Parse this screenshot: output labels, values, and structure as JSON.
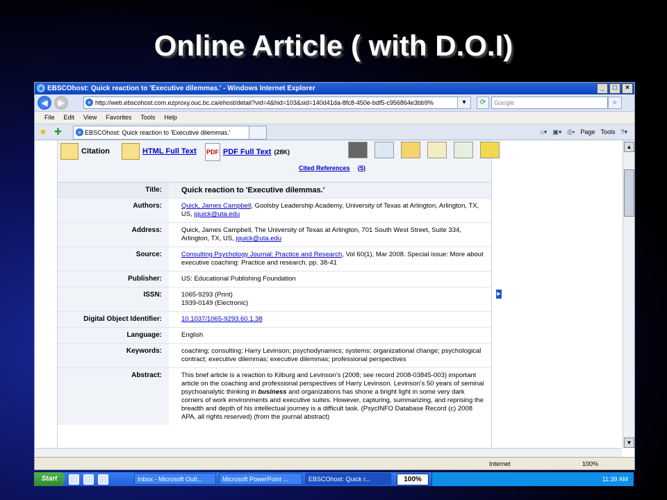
{
  "slide": {
    "title": "Online Article ( with D.O.I)"
  },
  "browser": {
    "window_title": "EBSCOhost: Quick reaction to 'Executive dilemmas.' - Windows Internet Explorer",
    "url": "http://web.ebscohost.com.ezproxy.ouc.bc.ca/ehost/detail?vid=4&hid=103&sid=140d41da-8fc8-450e-bdf5-c956864e3bb9%",
    "search_placeholder": "Google",
    "menu": [
      "File",
      "Edit",
      "View",
      "Favorites",
      "Tools",
      "Help"
    ],
    "tab_title": "EBSCOhost: Quick reaction to 'Executive dilemmas.'",
    "commands": [
      "Page",
      "Tools"
    ],
    "status": {
      "zone": "Internet",
      "zoom": "100%"
    }
  },
  "record": {
    "formats": {
      "citation": "Citation",
      "html": "HTML Full Text",
      "pdf": "PDF Full Text",
      "pdf_size": "(28K)"
    },
    "cited_references": "Cited References",
    "cited_count": "(5)",
    "fields": {
      "title_label": "Title:",
      "title": "Quick reaction to 'Executive dilemmas.'",
      "authors_label": "Authors:",
      "authors_link": "Quick, James Campbell",
      "authors_rest": ", Goolsby Leadership Academy, University of Texas at Arlington, Arlington, TX, US, ",
      "authors_email": "jquick@uta.edu",
      "address_label": "Address:",
      "address": "Quick, James Campbell, The University of Texas at Arlington, 701 South West Street, Suite 334, Arlington, TX, US, ",
      "address_email": "jquick@uta.edu",
      "source_label": "Source:",
      "source_link": "Consulting Psychology Journal: Practice and Research",
      "source_rest": ", Vol 60(1), Mar 2008. Special issue: More about executive coaching: Practice and research. pp. 38-41",
      "publisher_label": "Publisher:",
      "publisher": "US: Educational Publishing Foundation",
      "issn_label": "ISSN:",
      "issn_print": "1065-9293 (Print)",
      "issn_electronic": "1939-0149 (Electronic)",
      "doi_label": "Digital Object Identifier:",
      "doi": "10.1037/1065-9293.60.1.38",
      "language_label": "Language:",
      "language": "English",
      "keywords_label": "Keywords:",
      "keywords": "coaching; consulting; Harry Levinson; psychodynamics; systems; organizational change; psychological contract; executive dilemmas; executive dilemmas; professional perspectives",
      "abstract_label": "Abstract:",
      "abstract_a": "This brief article is a reaction to Kilburg and Levinson's (2008; see record 2008-03845-003) important article on the coaching and professional perspectives of Harry Levinson. Levinson's 50 years of seminal psychoanalytic thinking in ",
      "abstract_em": "business",
      "abstract_b": " and organizations has shone a bright light in some very dark corners of work environments and executive suites. However, capturing, summarizing, and reprising the breadth and depth of his intellectual journey is a difficult task. (PsycINFO Database Record (c) 2008 APA, all rights reserved) (from the journal abstract)"
    }
  },
  "taskbar": {
    "start": "Start",
    "buttons": [
      "Inbox - Microsoft Outl...",
      "Microsoft PowerPoint ...",
      "EBSCOhost: Quick r..."
    ],
    "progress": "100%",
    "clock": "11:39 AM"
  }
}
